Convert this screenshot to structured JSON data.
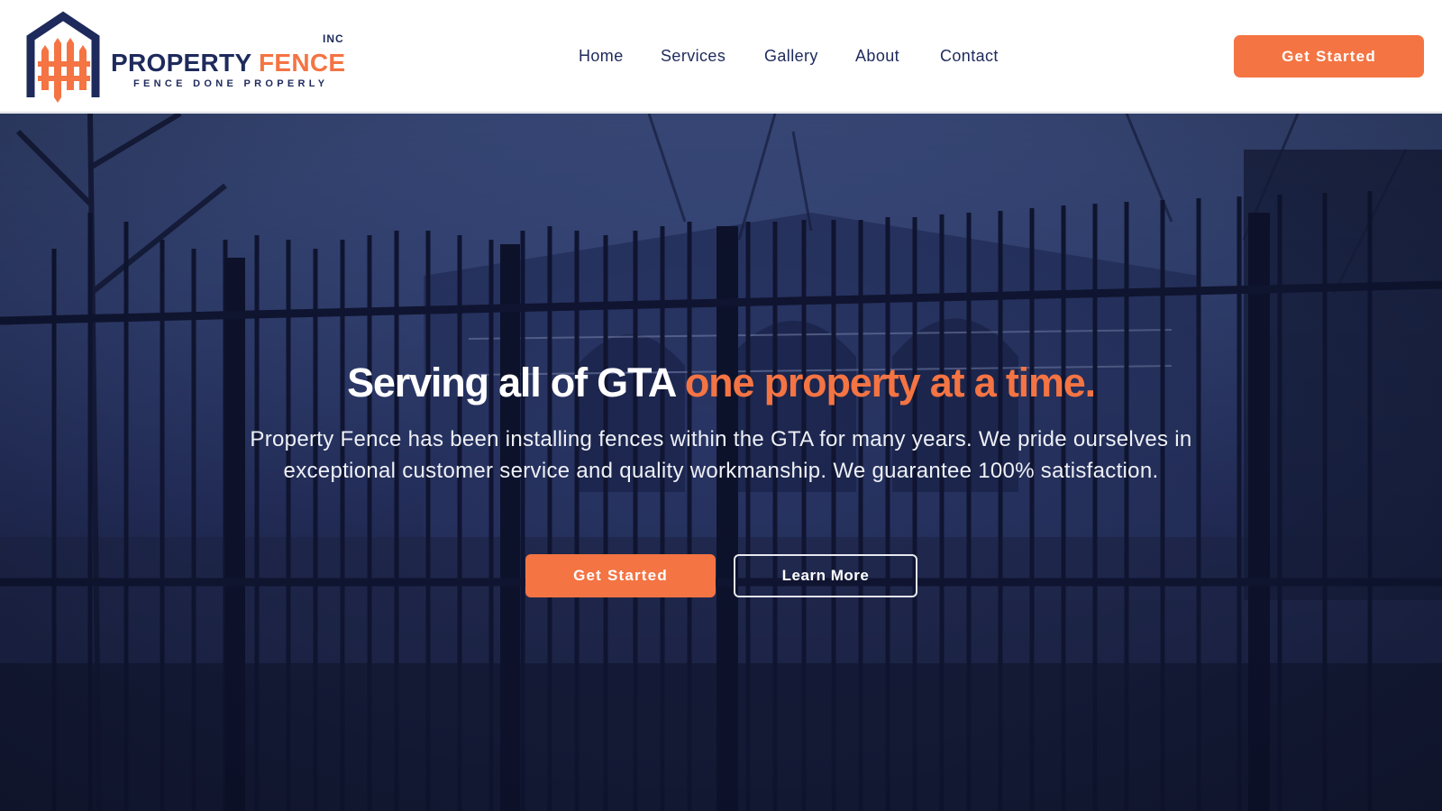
{
  "brand": {
    "name_part1": "PROPERTY",
    "name_part2": "FENCE",
    "suffix": "INC",
    "tagline": "FENCE DONE PROPERLY"
  },
  "nav": {
    "items": [
      {
        "label": "Home"
      },
      {
        "label": "Services"
      },
      {
        "label": "Gallery"
      },
      {
        "label": "About"
      },
      {
        "label": "Contact"
      }
    ],
    "cta_label": "Get Started"
  },
  "hero": {
    "title_main": "Serving all of GTA",
    "title_accent": "one property at a time.",
    "description": "Property Fence has been installing fences within the GTA for many years. We pride ourselves in exceptional customer service and quality workmanship. We guarantee 100% satisfaction.",
    "primary_label": "Get Started",
    "secondary_label": "Learn More",
    "background_icon": "iron-fence-house-photo"
  },
  "colors": {
    "brand_navy": "#1e2a5c",
    "brand_orange": "#f47443",
    "hero_overlay": "#3d4f86"
  }
}
